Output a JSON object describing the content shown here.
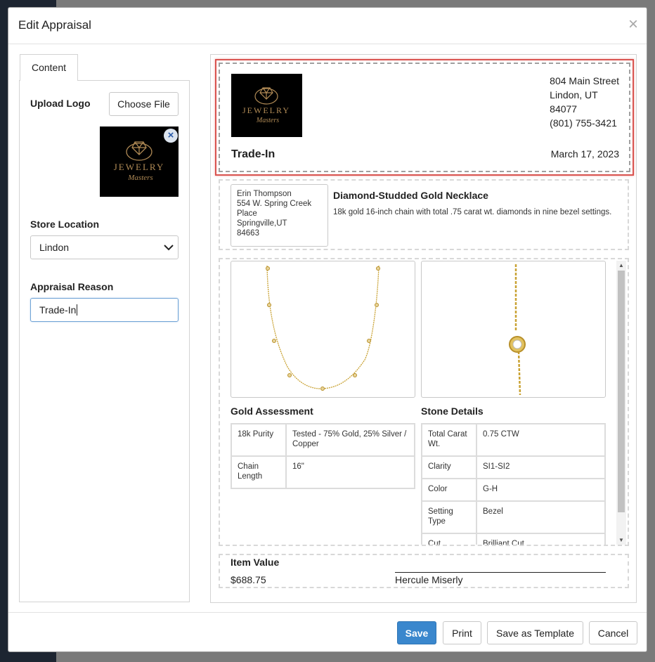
{
  "modal": {
    "title": "Edit Appraisal",
    "close_symbol": "×"
  },
  "sidebar": {
    "tab_label": "Content",
    "upload_logo_label": "Upload Logo",
    "choose_file_label": "Choose File",
    "remove_logo_symbol": "×",
    "store_location_label": "Store Location",
    "store_location_value": "Lindon",
    "appraisal_reason_label": "Appraisal Reason",
    "appraisal_reason_value": "Trade-In"
  },
  "logo": {
    "line1": "JEWELRY",
    "line2": "Masters",
    "colors": {
      "gold": "#b08a55",
      "bg": "#000000"
    }
  },
  "appraisal": {
    "address": [
      "804 Main Street",
      "Lindon, UT",
      "84077",
      "(801) 755-3421"
    ],
    "reason": "Trade-In",
    "date": "March 17, 2023",
    "customer": [
      "Erin Thompson",
      "554 W. Spring Creek",
      "Place",
      "Springville,UT",
      "84663"
    ],
    "item_title": "Diamond-Studded Gold Necklace",
    "item_description": "18k gold 16-inch chain with total .75 carat wt. diamonds in nine bezel settings.",
    "gold_assessment_title": "Gold Assessment",
    "gold_rows": [
      {
        "label": "18k Purity",
        "value": "Tested - 75% Gold, 25% Silver / Copper"
      },
      {
        "label": "Chain Length",
        "value": "16\""
      }
    ],
    "stone_details_title": "Stone Details",
    "stone_rows": [
      {
        "label": "Total Carat Wt.",
        "value": "0.75 CTW"
      },
      {
        "label": "Clarity",
        "value": "SI1-SI2"
      },
      {
        "label": "Color",
        "value": "G-H"
      },
      {
        "label": "Setting Type",
        "value": "Bezel"
      },
      {
        "label": "Cut",
        "value": "Brilliant Cut"
      }
    ],
    "item_value_label": "Item Value",
    "item_value": "$688.75",
    "signature_name": "Hercule Miserly"
  },
  "footer": {
    "save": "Save",
    "print": "Print",
    "save_template": "Save as Template",
    "cancel": "Cancel"
  },
  "colors": {
    "primary": "#3a87cd",
    "highlight": "#d9534f",
    "necklace_gold": "#c9a233"
  }
}
